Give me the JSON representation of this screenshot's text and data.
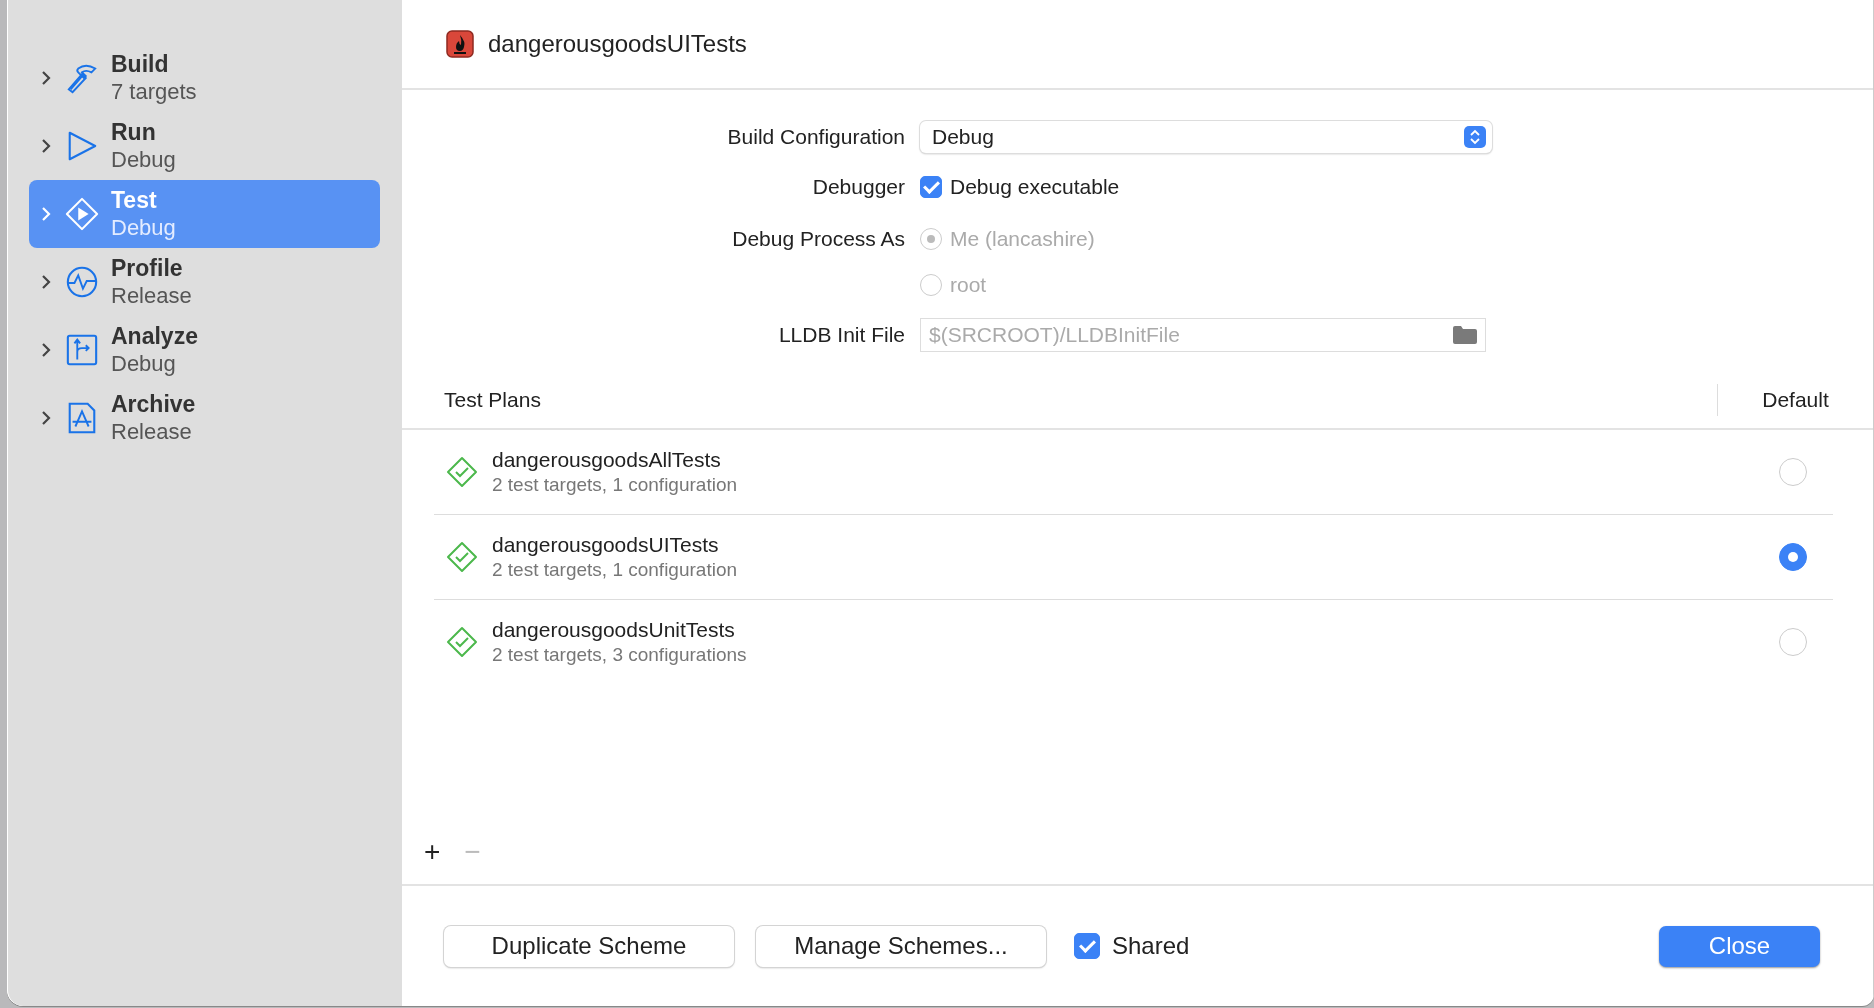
{
  "sidebar": {
    "items": [
      {
        "title": "Build",
        "subtitle": "7 targets",
        "kind": "hammer",
        "selected": false,
        "expanded": false
      },
      {
        "title": "Run",
        "subtitle": "Debug",
        "kind": "play",
        "selected": false,
        "expanded": false
      },
      {
        "title": "Test",
        "subtitle": "Debug",
        "kind": "diamond",
        "selected": true,
        "expanded": false
      },
      {
        "title": "Profile",
        "subtitle": "Release",
        "kind": "pulse",
        "selected": false,
        "expanded": false
      },
      {
        "title": "Analyze",
        "subtitle": "Debug",
        "kind": "branch",
        "selected": false,
        "expanded": false
      },
      {
        "title": "Archive",
        "subtitle": "Release",
        "kind": "appstore",
        "selected": false,
        "expanded": false
      }
    ]
  },
  "header": {
    "title": "dangerousgoodsUITests"
  },
  "form": {
    "build_configuration": {
      "label": "Build Configuration",
      "value": "Debug"
    },
    "debugger": {
      "label": "Debugger",
      "option": "Debug executable",
      "checked": true
    },
    "debug_process_as": {
      "label": "Debug Process As",
      "options": [
        {
          "label": "Me (lancashire)",
          "selected": true,
          "disabled": true
        },
        {
          "label": "root",
          "selected": false,
          "disabled": true
        }
      ]
    },
    "lldb_init_file": {
      "label": "LLDB Init File",
      "placeholder": "$(SRCROOT)/LLDBInitFile"
    }
  },
  "test_plans": {
    "columns": [
      "Test Plans",
      "Default"
    ],
    "rows": [
      {
        "name": "dangerousgoodsAllTests",
        "detail": "2 test targets, 1 configuration",
        "selected": false
      },
      {
        "name": "dangerousgoodsUITests",
        "detail": "2 test targets, 1 configuration",
        "selected": true
      },
      {
        "name": "dangerousgoodsUnitTests",
        "detail": "2 test targets, 3 configurations",
        "selected": false
      }
    ],
    "add": "+",
    "remove": "−",
    "remove_disabled": true
  },
  "footer": {
    "buttons": [
      "Duplicate Scheme",
      "Manage Schemes..."
    ],
    "shared": {
      "label": "Shared",
      "checked": true
    },
    "close": "Close"
  }
}
